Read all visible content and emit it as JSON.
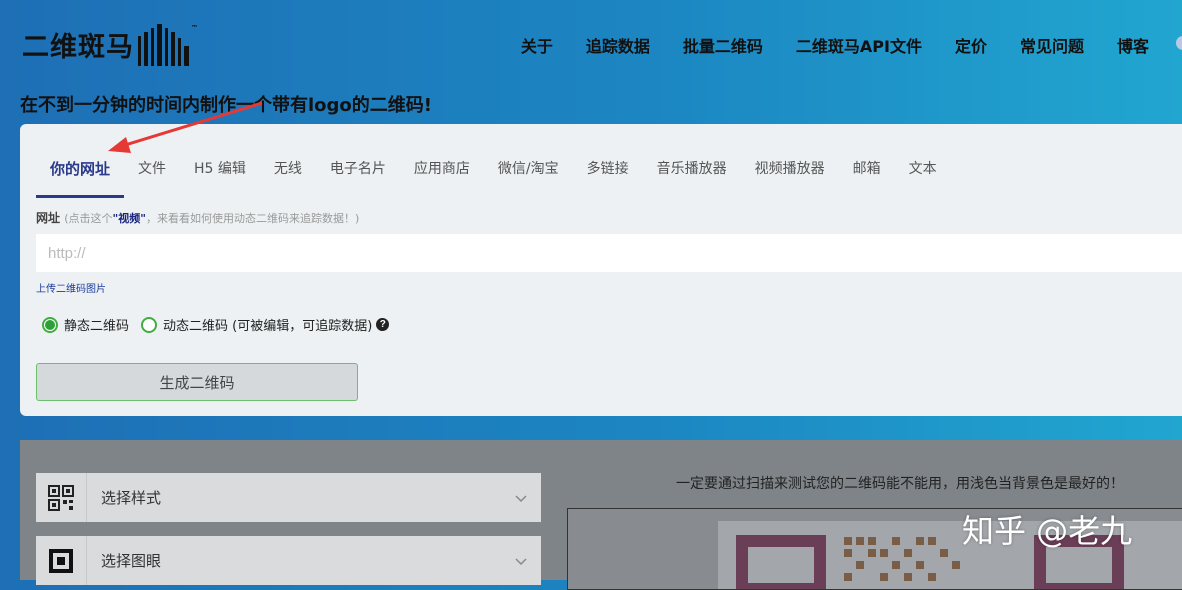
{
  "brand": {
    "logo_text": "二维斑马",
    "tm": "™"
  },
  "nav": {
    "items": [
      "关于",
      "追踪数据",
      "批量二维码",
      "二维斑马API文件",
      "定价",
      "常见问题",
      "博客"
    ]
  },
  "tagline": "在不到一分钟的时间内制作一个带有logo的二维码!",
  "tabs": [
    "你的网址",
    "文件",
    "H5 编辑",
    "无线",
    "电子名片",
    "应用商店",
    "微信/淘宝",
    "多链接",
    "音乐播放器",
    "视频播放器",
    "邮箱",
    "文本"
  ],
  "url_field": {
    "label": "网址",
    "hint_prefix": "(点击这个",
    "hint_video": "\"视频\"",
    "hint_suffix": "，来看看如何使用动态二维码来追踪数据！)",
    "placeholder": "http://"
  },
  "upload_link": "上传二维码图片",
  "radios": {
    "static": {
      "label": "静态二维码",
      "checked": true
    },
    "dynamic": {
      "label": "动态二维码 (可被编辑，可追踪数据)",
      "checked": false
    }
  },
  "generate_button": "生成二维码",
  "accordion": [
    {
      "label": "选择样式",
      "icon": "qr-code-icon"
    },
    {
      "label": "选择图眼",
      "icon": "qr-eye-icon"
    }
  ],
  "test_note": "一定要通过扫描来测试您的二维码能不能用，用浅色当背景色是最好的！",
  "watermark": "知乎 @老九",
  "colors": {
    "accent": "#2a3a8a",
    "radio_green": "#2e9e3a",
    "annotation_red": "#e53935",
    "header_gradient_start": "#1e6fb5",
    "header_gradient_end": "#21a6d0"
  }
}
